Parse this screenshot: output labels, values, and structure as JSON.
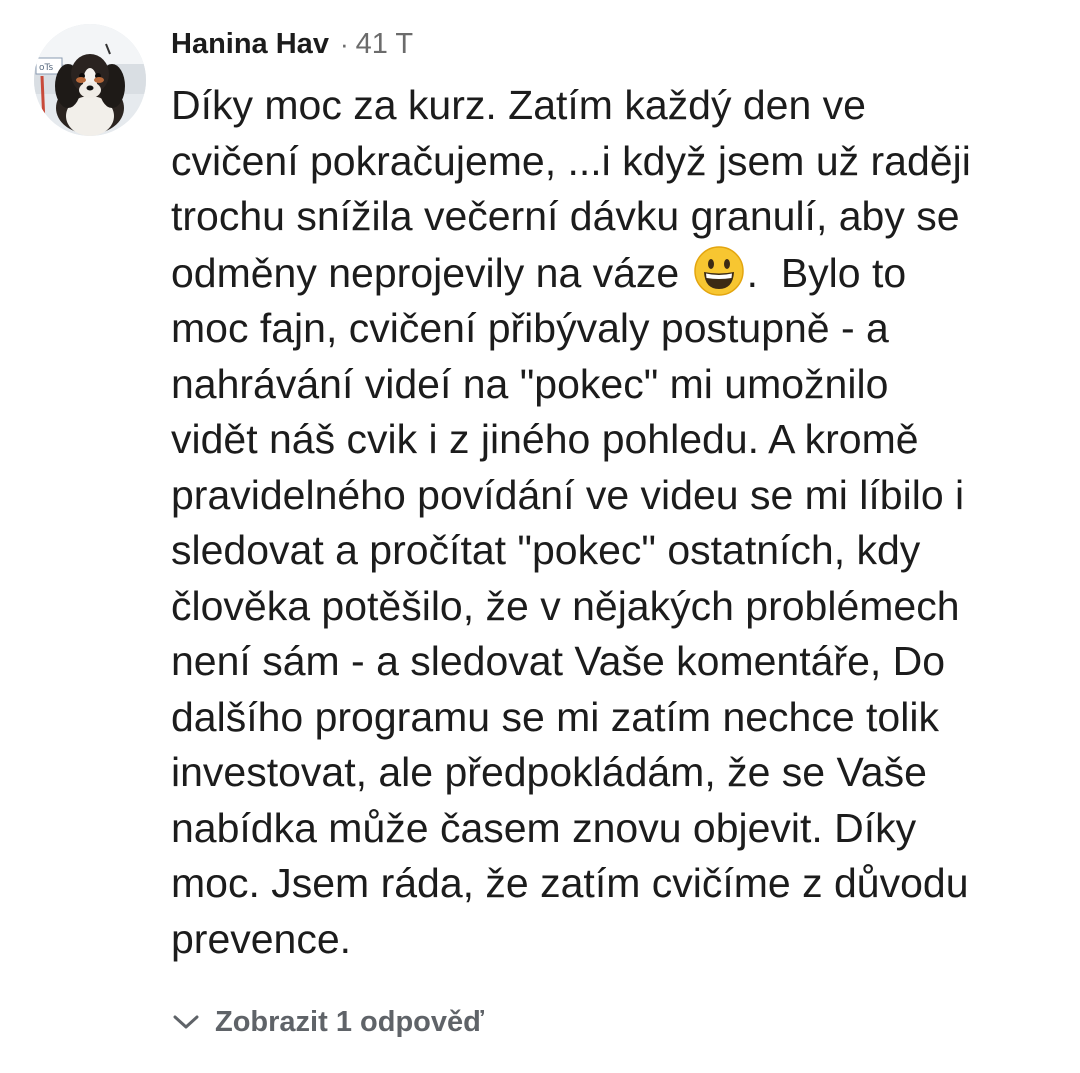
{
  "comment": {
    "author": "Hanina Hav",
    "separator": "·",
    "timestamp": "41 T",
    "text_before_emoji": "Díky moc za kurz. Zatím každý den ve\ncvičení pokračujeme, ...i když jsem už raději\ntrochu snížila večerní dávku granulí, aby se\nodměny neprojevily na váze ",
    "emoji": "grinning-face-emoji",
    "text_after_emoji": ".  Bylo to\nmoc fajn, cvičení přibývaly postupně - a\nnahrávání videí na \"pokec\" mi umožnilo\nvidět náš cvik i z jiného pohledu. A kromě\npravidelného povídání ve videu se mi líbilo i\nsledovat a pročítat \"pokec\" ostatních, kdy\nčlověka potěšilo, že v nějakých problémech\nnení sám - a sledovat Vaše komentáře, Do\ndalšího programu se mi zatím nechce tolik\ninvestovat, ale předpokládám, že se Vaše\nnabídka může časem znovu objevit. Díky\nmoc. Jsem ráda, že zatím cvičíme z důvodu\nprevence."
  },
  "replies": {
    "label": "Zobrazit 1 odpověď",
    "icon": "chevron-down-icon"
  },
  "colors": {
    "text": "#1c1c1c",
    "meta": "#6b6b6b",
    "replies": "#5f6368",
    "emoji": "#f7c631"
  }
}
